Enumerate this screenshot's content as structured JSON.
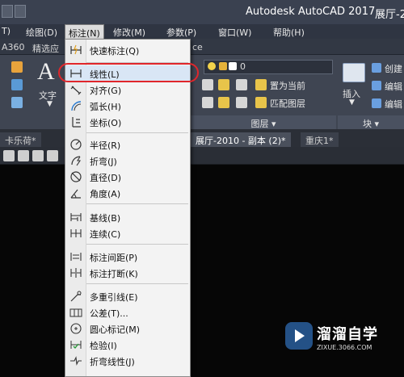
{
  "window": {
    "title": "Autodesk AutoCAD 2017",
    "doc_title_partial": "展厅-2("
  },
  "menubar": {
    "items": [
      "T)",
      "绘图(D)",
      "标注(N)",
      "修改(M)",
      "参数(P)",
      "窗口(W)",
      "帮助(H)"
    ]
  },
  "ribbon_tabs": {
    "items": [
      "A360",
      "精选应",
      "ce"
    ]
  },
  "ribbon": {
    "text_label": "文字",
    "layer_value": "0",
    "set_current": "置为当前",
    "match_layer": "匹配图层",
    "layers_panel": "图层",
    "insert_label": "插入",
    "create_label": "创建",
    "edit_label": "编辑",
    "edit_attr_label": "编辑",
    "block_panel": "块"
  },
  "doc_tabs": {
    "items": [
      "卡乐荷*",
      "展厅-2010 - 副本 (2)*",
      "重庆1*"
    ]
  },
  "dropdown": {
    "items": [
      {
        "label": "快速标注(Q)",
        "icon": "quick-dimension-icon"
      },
      {
        "label": "线性(L)",
        "icon": "linear-dimension-icon"
      },
      {
        "label": "对齐(G)",
        "icon": "aligned-dimension-icon"
      },
      {
        "label": "弧长(H)",
        "icon": "arc-length-icon"
      },
      {
        "label": "坐标(O)",
        "icon": "ordinate-icon"
      },
      {
        "label": "半径(R)",
        "icon": "radius-icon"
      },
      {
        "label": "折弯(J)",
        "icon": "jogged-icon"
      },
      {
        "label": "直径(D)",
        "icon": "diameter-icon"
      },
      {
        "label": "角度(A)",
        "icon": "angular-icon"
      },
      {
        "label": "基线(B)",
        "icon": "baseline-icon"
      },
      {
        "label": "连续(C)",
        "icon": "continue-icon"
      },
      {
        "label": "标注间距(P)",
        "icon": "dim-space-icon"
      },
      {
        "label": "标注打断(K)",
        "icon": "dim-break-icon"
      },
      {
        "label": "多重引线(E)",
        "icon": "multileader-icon"
      },
      {
        "label": "公差(T)...",
        "icon": "tolerance-icon"
      },
      {
        "label": "圆心标记(M)",
        "icon": "center-mark-icon"
      },
      {
        "label": "检验(I)",
        "icon": "inspection-icon"
      },
      {
        "label": "折弯线性(J)",
        "icon": "jogged-linear-icon"
      }
    ]
  },
  "watermark": {
    "name": "溜溜自学",
    "url": "ZIXUE.3066.COM"
  },
  "colors": {
    "highlight": "#e0262b",
    "titlebar": "#3a4150",
    "menu_bg": "#f3f3f3"
  }
}
